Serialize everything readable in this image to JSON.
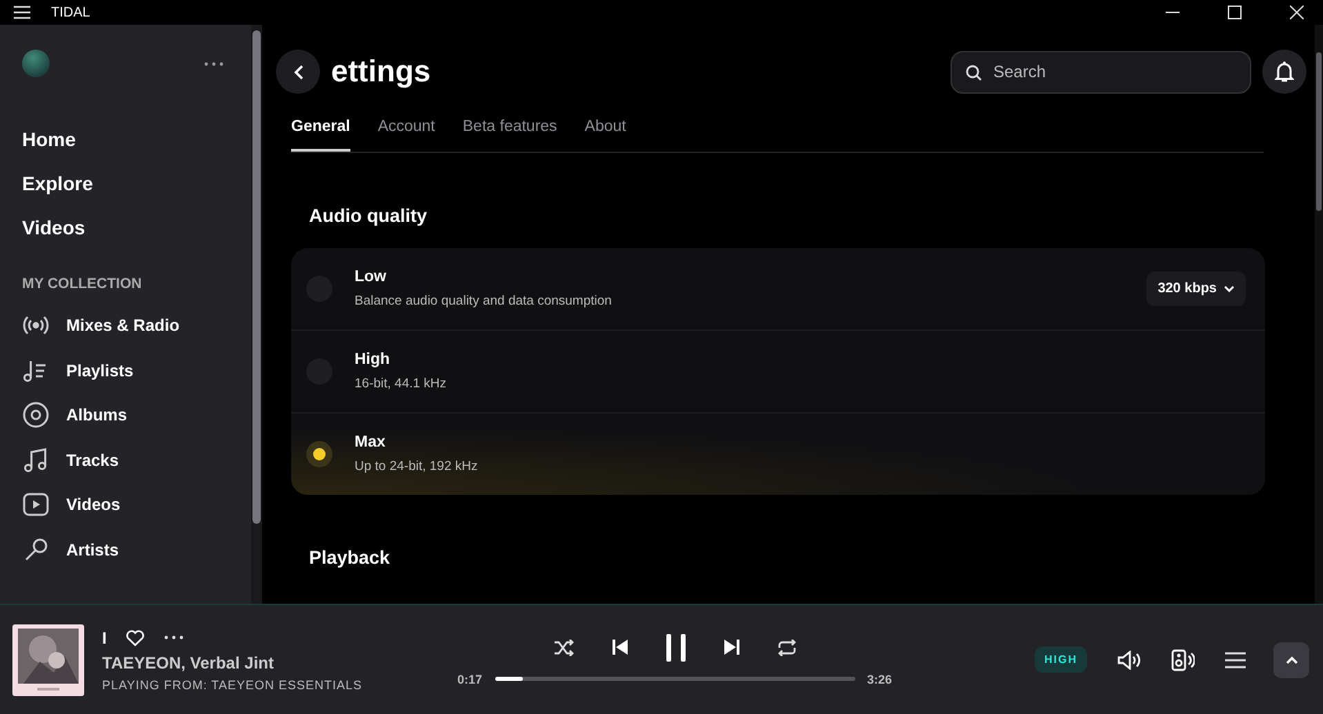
{
  "window": {
    "app_name": "TIDAL"
  },
  "sidebar": {
    "nav": [
      {
        "label": "Home"
      },
      {
        "label": "Explore"
      },
      {
        "label": "Videos"
      }
    ],
    "section_title": "MY COLLECTION",
    "collection": [
      {
        "label": "Mixes & Radio"
      },
      {
        "label": "Playlists"
      },
      {
        "label": "Albums"
      },
      {
        "label": "Tracks"
      },
      {
        "label": "Videos"
      },
      {
        "label": "Artists"
      }
    ]
  },
  "page": {
    "title": "ettings",
    "search": {
      "placeholder": "Search"
    },
    "tabs": [
      {
        "label": "General",
        "selected": true
      },
      {
        "label": "Account",
        "selected": false
      },
      {
        "label": "Beta features",
        "selected": false
      },
      {
        "label": "About",
        "selected": false
      }
    ],
    "section": "Audio quality",
    "quality_options": [
      {
        "name": "Low",
        "description": "Balance audio quality and data consumption",
        "selected": false,
        "dropdown": "320 kbps"
      },
      {
        "name": "High",
        "description": "16-bit, 44.1 kHz",
        "selected": false
      },
      {
        "name": "Max",
        "description": "Up to 24-bit, 192 kHz",
        "selected": true
      }
    ],
    "next_section": "Playback"
  },
  "player": {
    "track": "I",
    "artists": "TAEYEON, Verbal Jint",
    "playing_from": "PLAYING FROM: TAEYEON ESSENTIALS",
    "elapsed": "0:17",
    "duration": "3:26",
    "level": 0.08,
    "quality_badge": "HIGH"
  }
}
